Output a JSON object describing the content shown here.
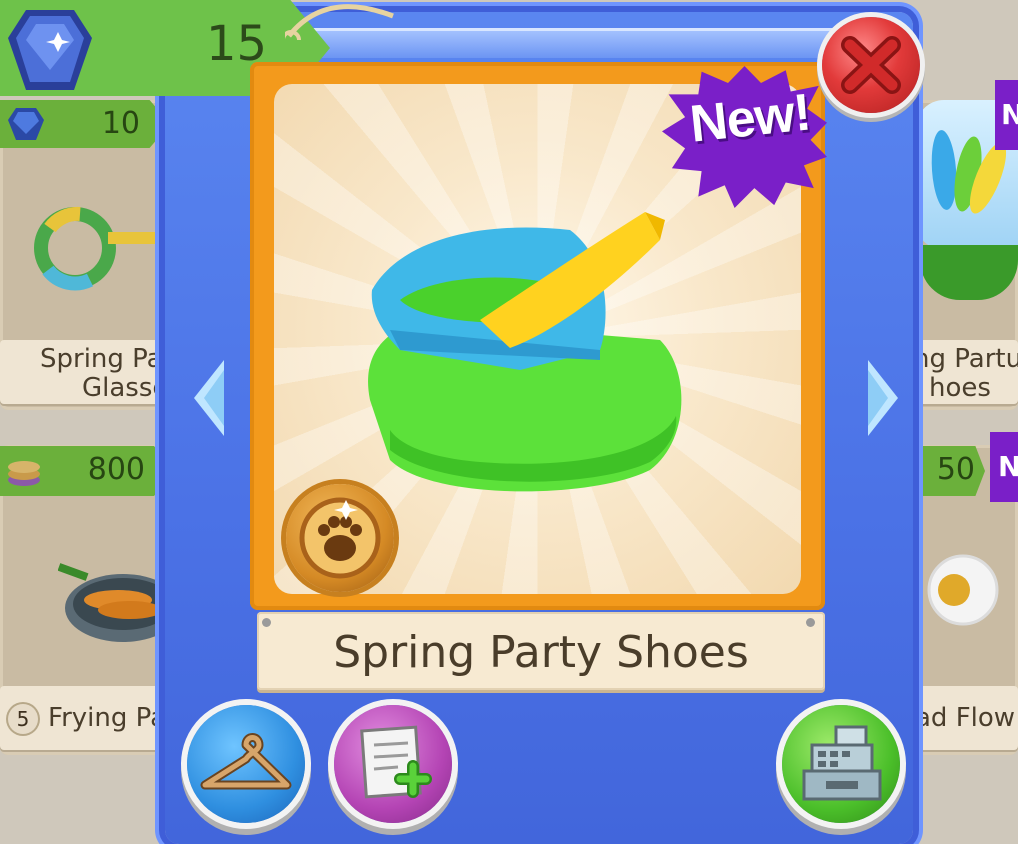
{
  "currency": {
    "gems": "15"
  },
  "background_items": {
    "left": [
      {
        "price": "10",
        "label_line1": "Spring Pa",
        "label_line2": "Glasse"
      },
      {
        "price": "800",
        "label_line1": "Frying Pa",
        "label_line2": "",
        "stock": "5"
      }
    ],
    "right": [
      {
        "badge": "N",
        "label_line1": "ng Partu",
        "label_line2": "hoes"
      },
      {
        "price": "50",
        "badge": "N",
        "label_line1": "ad Flow",
        "label_line2": ""
      }
    ]
  },
  "item": {
    "name": "Spring Party Shoes",
    "badge": "New!",
    "category_icon": "clans-paw-icon"
  },
  "buttons": {
    "close": "close-icon",
    "wear": "hanger-icon",
    "wishlist": "add-to-list-icon",
    "buy": "cash-register-icon"
  },
  "colors": {
    "modal": "#4b72e6",
    "frame": "#f39a1c",
    "new_badge": "#7a1fc8",
    "price_tag": "#6bb03b",
    "close": "#e23a3a",
    "buy": "#4bbf2a",
    "wishlist": "#b444b4",
    "wear": "#2f8fe0"
  }
}
